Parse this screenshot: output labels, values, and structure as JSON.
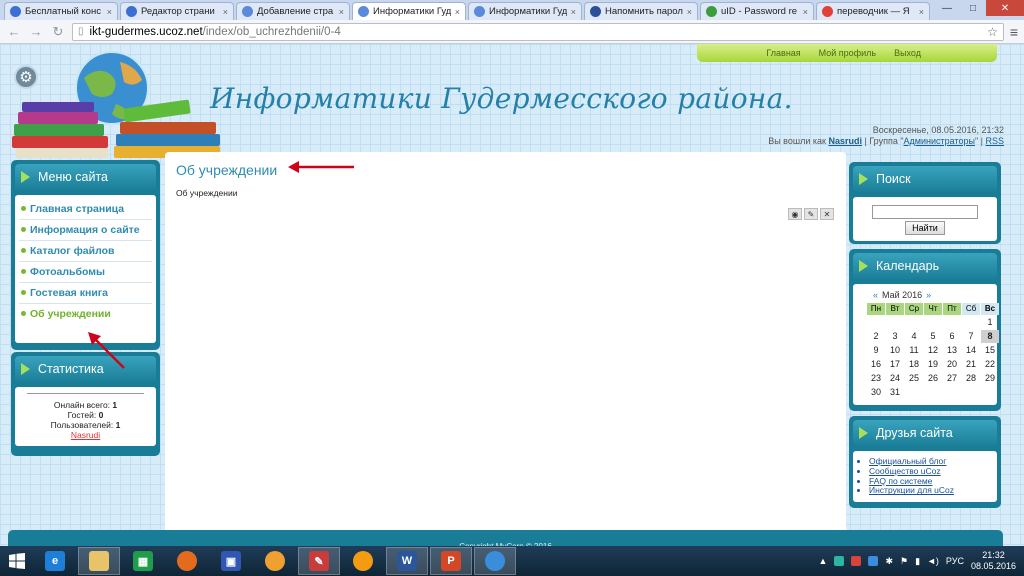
{
  "browser": {
    "tabs": [
      {
        "label": "Бесплатный конс",
        "icon": "ucoz-icon",
        "color": "#3b6fd1",
        "active": false
      },
      {
        "label": "Редактор страни",
        "icon": "ucoz-icon",
        "color": "#3b6fd1",
        "active": false
      },
      {
        "label": "Добавление стра",
        "icon": "ucoz-icon",
        "color": "#5a8ad8",
        "active": false
      },
      {
        "label": "Информатики Гуд",
        "icon": "ucoz-icon",
        "color": "#5a8ad8",
        "active": true
      },
      {
        "label": "Информатики Гуд",
        "icon": "ucoz-icon",
        "color": "#5a8ad8",
        "active": false
      },
      {
        "label": "Напомнить парол",
        "icon": "ucoz-u-icon",
        "color": "#2c4f9a",
        "active": false
      },
      {
        "label": "uID - Password re",
        "icon": "uid-icon",
        "color": "#3b9d3b",
        "active": false
      },
      {
        "label": "переводчик — Я",
        "icon": "yandex-icon",
        "color": "#e2413a",
        "active": false
      }
    ],
    "url_host": "ikt-gudermes.ucoz.net",
    "url_path": "/index/ob_uchrezhdenii/0-4"
  },
  "site": {
    "top_menu": [
      "Главная",
      "Мой профиль",
      "Выход"
    ],
    "title": "Информатики Гудермесского района.",
    "date": "Воскресенье, 08.05.2016, 21:32",
    "login_prefix": "Вы вошли как",
    "login_user": "Nasrudi",
    "login_group_prefix": " | Группа \"",
    "login_group": "Администраторы",
    "login_group_suffix": "\" | ",
    "rss": "RSS"
  },
  "menu_block": {
    "title": "Меню сайта",
    "items": [
      {
        "label": "Главная страница",
        "current": false
      },
      {
        "label": "Информация о сайте",
        "current": false
      },
      {
        "label": "Каталог файлов",
        "current": false
      },
      {
        "label": "Фотоальбомы",
        "current": false
      },
      {
        "label": "Гостевая книга",
        "current": false
      },
      {
        "label": "Об учреждении",
        "current": true
      }
    ]
  },
  "stats_block": {
    "title": "Статистика",
    "online_label": "Онлайн всего:",
    "online_value": "1",
    "guests_label": "Гостей:",
    "guests_value": "0",
    "users_label": "Пользователей:",
    "users_value": "1",
    "user_name": "Nasrudi"
  },
  "content": {
    "title": "Об учреждении",
    "text": "Об учреждении"
  },
  "search_block": {
    "title": "Поиск",
    "button": "Найти"
  },
  "calendar_block": {
    "title": "Календарь",
    "month": "Май 2016",
    "prev": "«",
    "next": "»",
    "days": [
      "Пн",
      "Вт",
      "Ср",
      "Чт",
      "Пт",
      "Сб",
      "Вс"
    ],
    "today": 8
  },
  "friends_block": {
    "title": "Друзья сайта",
    "links": [
      "Официальный блог",
      "Сообщество uCoz",
      "FAQ по системе",
      "Инструкции для uCoz"
    ]
  },
  "footer": "Copyright MyCorp © 2016",
  "taskbar": {
    "lang": "РУС",
    "time": "21:32",
    "date": "08.05.2016"
  },
  "colors": {
    "accent": "#2e8cb0",
    "block": "#1a7d98",
    "green": "#a6e05a",
    "arrow": "#d0021b"
  }
}
